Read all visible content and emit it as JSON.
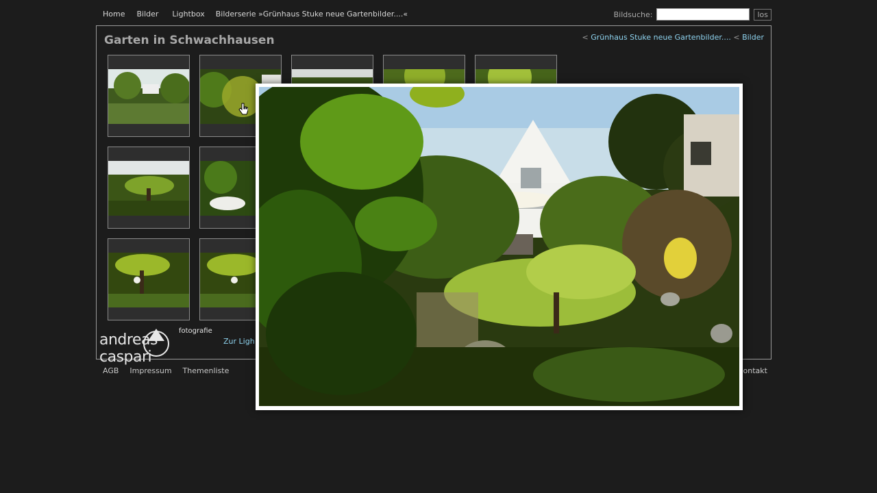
{
  "nav": {
    "items": [
      "Home",
      "Bilder",
      "Lightbox",
      "Bilderserie »Grünhaus Stuke neue Gartenbilder....«"
    ]
  },
  "search": {
    "label": "Bildsuche:",
    "value": "",
    "button": "los"
  },
  "gallery": {
    "title": "Garten in Schwachhausen",
    "breadcrumb": {
      "sep1": "<",
      "series": "Grünhaus Stuke neue Gartenbilder....",
      "sep2": "<",
      "bilder": "Bilder"
    },
    "lightbox_link": "Zur Ligh"
  },
  "logo": {
    "name": "andreas caspari",
    "tagline": "fotografie"
  },
  "footer": {
    "items": [
      "AGB",
      "Impressum",
      "Themenliste"
    ],
    "kontakt": "ontakt"
  },
  "colors": {
    "background": "#1c1c1c",
    "link": "#8fd4f0",
    "frame_border": "#9a9a9a"
  }
}
